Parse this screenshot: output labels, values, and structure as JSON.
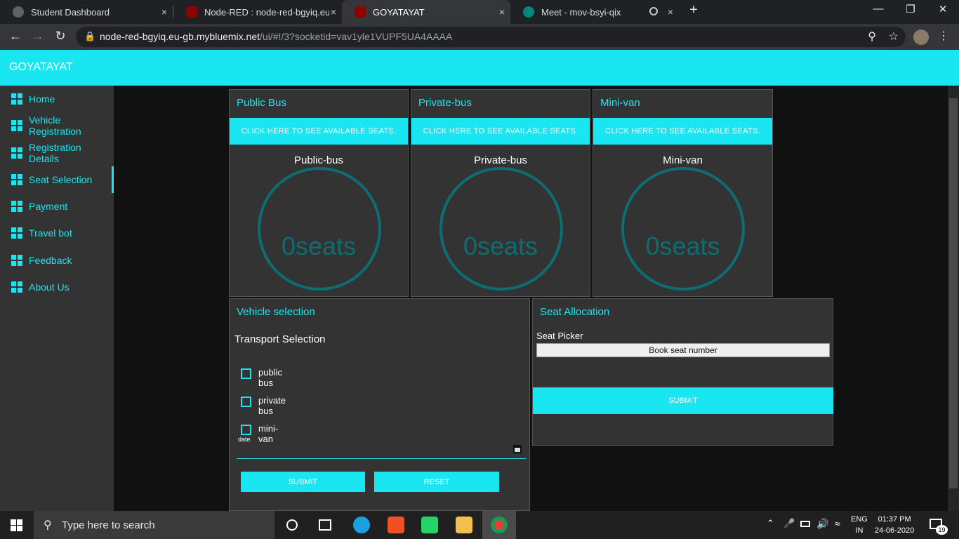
{
  "browser": {
    "tabs": [
      {
        "title": "Student Dashboard",
        "close": "×"
      },
      {
        "title": "Node-RED : node-red-bgyiq.eu-g",
        "close": "×"
      },
      {
        "title": "GOYATAYAT",
        "close": "×"
      },
      {
        "title": "Meet - mov-bsyi-qix",
        "close": "×"
      }
    ],
    "new_tab": "+",
    "url_host": "node-red-bgyiq.eu-gb.mybluemix.net",
    "url_path": "/ui/#!/3?socketid=vav1yle1VUPF5UA4AAAA"
  },
  "app": {
    "title": "GOYATAYAT",
    "accent": "#19e6f0"
  },
  "sidebar": {
    "items": [
      {
        "label": "Home"
      },
      {
        "label": "Vehicle Registration"
      },
      {
        "label": "Registration Details"
      },
      {
        "label": "Seat Selection",
        "active": true
      },
      {
        "label": "Payment"
      },
      {
        "label": "Travel bot"
      },
      {
        "label": "Feedback"
      },
      {
        "label": "About Us"
      }
    ]
  },
  "cards": [
    {
      "title": "Public Bus",
      "button": "CLICK HERE TO SEE AVAILABLE SEATS.",
      "gauge_label": "Public-bus",
      "gauge_value": "0seats"
    },
    {
      "title": "Private-bus",
      "button": "CLICK HERE TO SEE AVAILABLE SEATS.",
      "gauge_label": "Private-bus",
      "gauge_value": "0seats"
    },
    {
      "title": "Mini-van",
      "button": "CLICK HERE TO SEE AVAILABLE SEATS.",
      "gauge_label": "Mini-van",
      "gauge_value": "0seats"
    }
  ],
  "vehicle_selection": {
    "title": "Vehicle selection",
    "subtitle": "Transport Selection",
    "options": [
      {
        "label": "public bus",
        "checked": false
      },
      {
        "label": "private bus",
        "checked": false
      },
      {
        "label": "mini-van",
        "checked": false
      }
    ],
    "date_label": "date",
    "submit": "SUBMIT",
    "reset": "RESET"
  },
  "seat_allocation": {
    "title": "Seat Allocation",
    "picker_label": "Seat Picker",
    "picker_button": "Book seat number",
    "submit": "SUBMIT"
  },
  "taskbar": {
    "search_placeholder": "Type here to search",
    "lang": "ENG",
    "region": "IN",
    "time": "01:37 PM",
    "date": "24-06-2020",
    "notifications": "19"
  }
}
